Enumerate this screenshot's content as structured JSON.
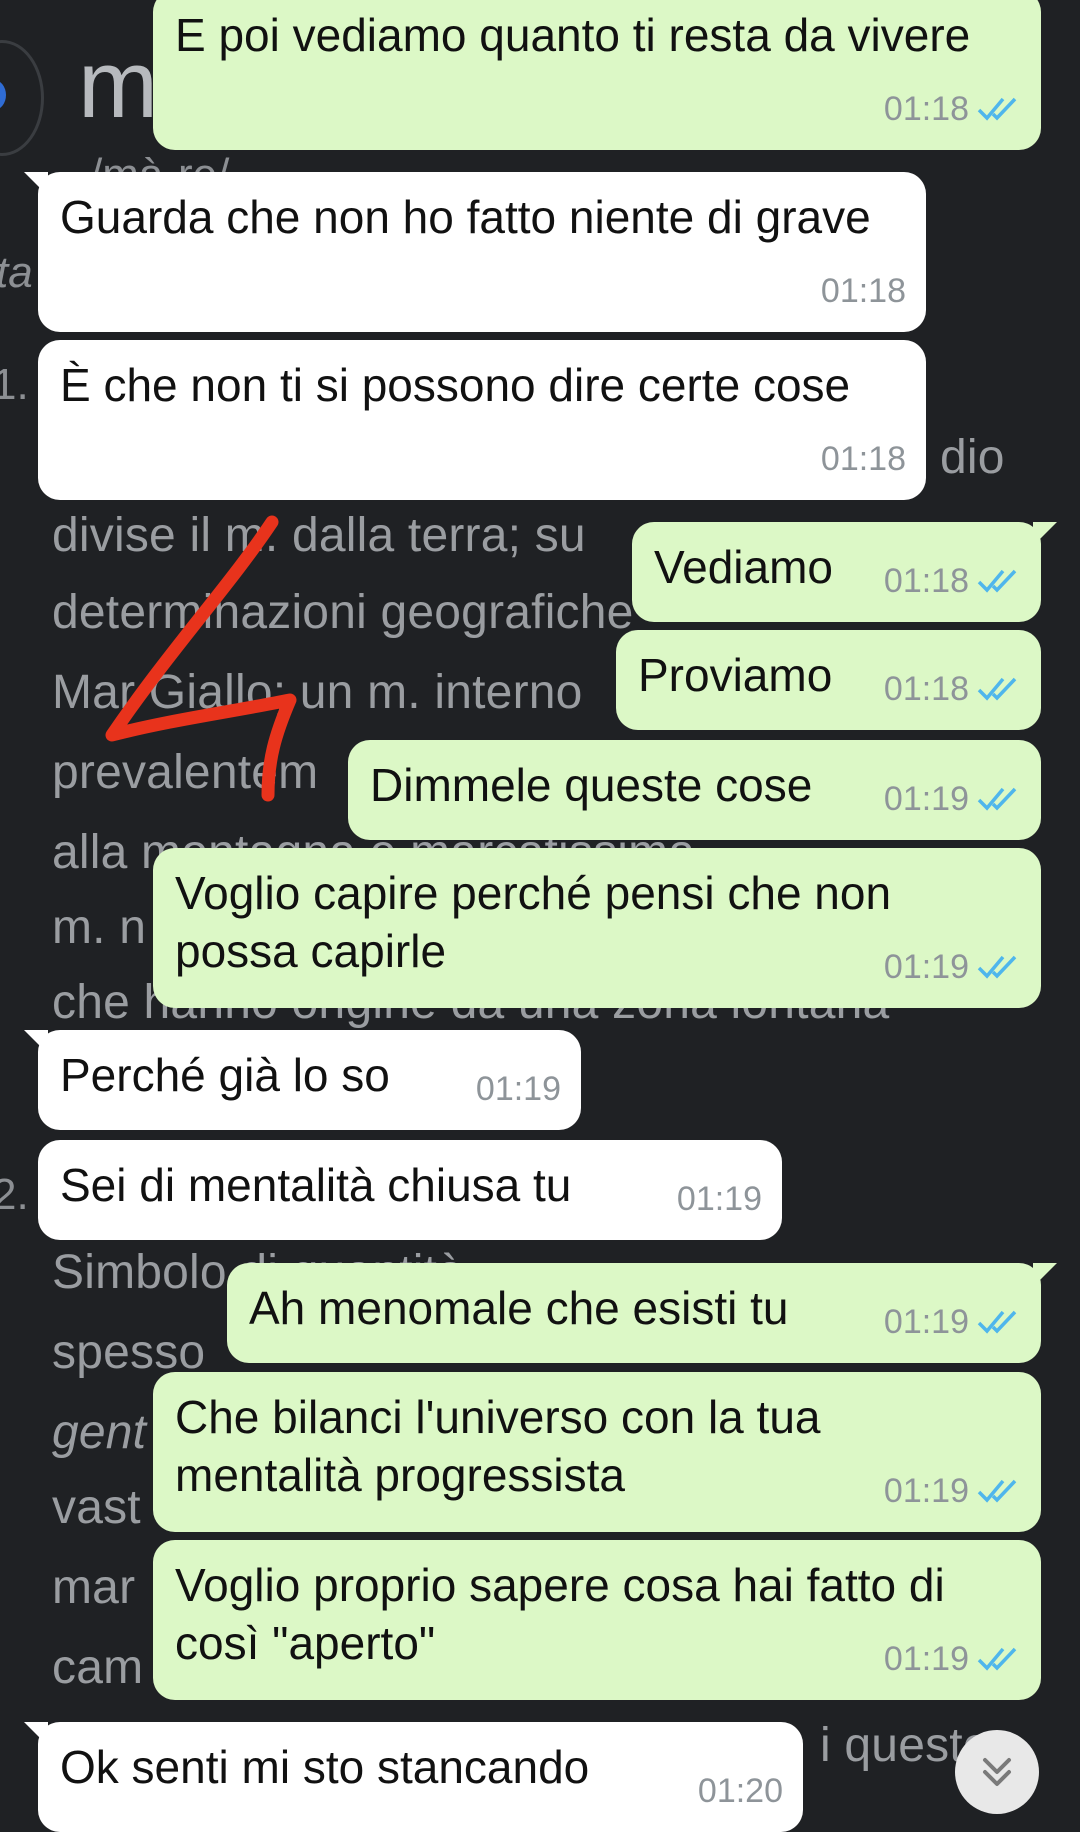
{
  "background": {
    "big_letter": "m",
    "pron": "/mà-re/",
    "edge_ta": "ta",
    "num1": "1.",
    "num2": "2.",
    "lines": [
      {
        "text": "dio",
        "right": true
      },
      {
        "text": "divise il m. dalla terra; su"
      },
      {
        "text": "determinazioni geografiche"
      },
      {
        "text": "Mar Giallo; un m. interno"
      },
      {
        "text": "prevalentem"
      },
      {
        "text": "alla montagna e marcatissima"
      },
      {
        "text": "m. n"
      },
      {
        "text": "che hanno origine da una zona lontana"
      },
      {
        "text": "Simbolo di quantità"
      },
      {
        "text": "spesso"
      },
      {
        "text": "gent"
      },
      {
        "text": "vast"
      },
      {
        "text": "mar"
      },
      {
        "text": "cam"
      },
      {
        "text": "i questo"
      }
    ]
  },
  "messages": [
    {
      "dir": "out",
      "text": "E poi vediamo quanto ti resta da vivere",
      "time": "01:18",
      "read": true
    },
    {
      "dir": "in",
      "text": "Guarda che non ho fatto niente di grave",
      "time": "01:18"
    },
    {
      "dir": "in",
      "text": "È che non ti si possono dire certe cose",
      "time": "01:18"
    },
    {
      "dir": "out",
      "text": "Vediamo",
      "time": "01:18",
      "read": true
    },
    {
      "dir": "out",
      "text": "Proviamo",
      "time": "01:18",
      "read": true
    },
    {
      "dir": "out",
      "text": "Dimmele queste cose",
      "time": "01:19",
      "read": true
    },
    {
      "dir": "out",
      "text": "Voglio capire perché pensi che non possa capirle",
      "time": "01:19",
      "read": true
    },
    {
      "dir": "in",
      "text": "Perché già lo so",
      "time": "01:19"
    },
    {
      "dir": "in",
      "text": "Sei di mentalità chiusa tu",
      "time": "01:19"
    },
    {
      "dir": "out",
      "text": "Ah menomale che esisti tu",
      "time": "01:19",
      "read": true
    },
    {
      "dir": "out",
      "text": "Che bilanci l'universo con la tua mentalità progressista",
      "time": "01:19",
      "read": true
    },
    {
      "dir": "out",
      "text": "Voglio proprio sapere cosa hai fatto di così \"aperto\"",
      "time": "01:19",
      "read": true
    },
    {
      "dir": "in",
      "text": "Ok senti mi sto stancando",
      "time": "01:20"
    }
  ],
  "colors": {
    "incoming": "#ffffff",
    "outgoing": "#dcf8c6",
    "read_ticks": "#4fb6ec",
    "annotation": "#e8331c"
  },
  "icons": {
    "ticks": "double-check-icon",
    "scroll": "chevron-double-down-icon"
  }
}
